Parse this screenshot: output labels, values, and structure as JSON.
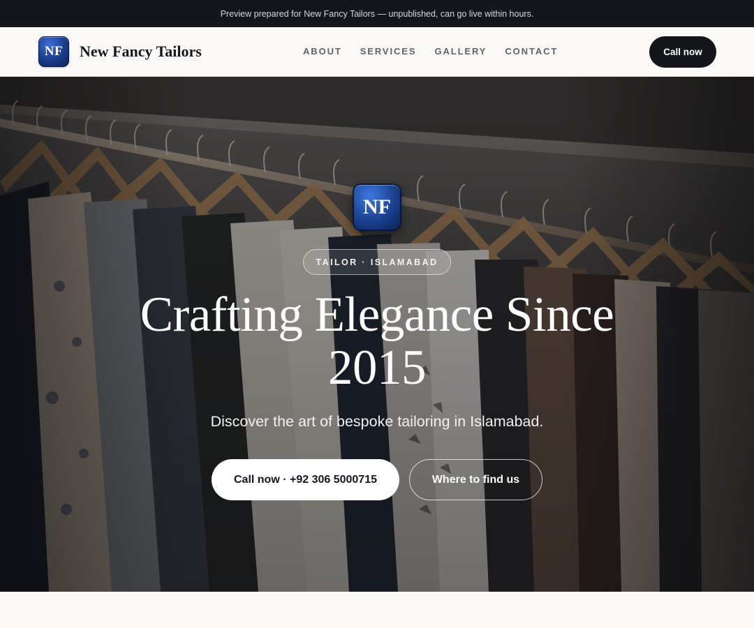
{
  "announcement": {
    "text": "Preview prepared for New Fancy Tailors — unpublished, can go live within hours."
  },
  "header": {
    "logo_initials": "NF",
    "brand_name": "New Fancy Tailors",
    "nav": [
      {
        "label": "ABOUT"
      },
      {
        "label": "SERVICES"
      },
      {
        "label": "GALLERY"
      },
      {
        "label": "CONTACT"
      }
    ],
    "cta_label": "Call now"
  },
  "hero": {
    "background_image": "clothing-rack-photo",
    "logo_initials": "NF",
    "badge": "TAILOR · ISLAMABAD",
    "title": "Crafting Elegance Since 2015",
    "subtitle": "Discover the art of bespoke tailoring in Islamabad.",
    "primary_button": "Call now · +92 306 5000715",
    "secondary_button": "Where to find us"
  },
  "colors": {
    "announcement_bg": "#14161b",
    "page_bg": "#faf9f6",
    "logo_blue": "#1a3c8c",
    "dark": "#14161b"
  }
}
